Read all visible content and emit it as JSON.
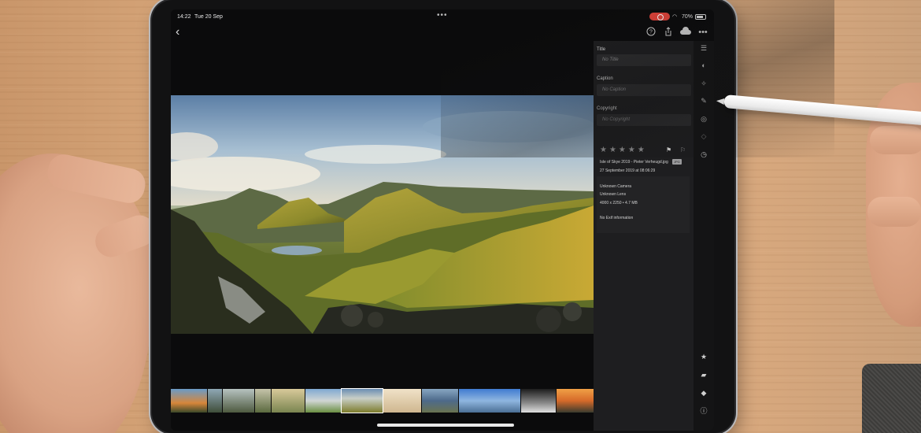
{
  "status_bar": {
    "time": "14:22",
    "date": "Tue 20 Sep",
    "battery": "70%"
  },
  "info_panel": {
    "title_label": "Title",
    "title_placeholder": "No Title",
    "caption_label": "Caption",
    "caption_placeholder": "No Caption",
    "copyright_label": "Copyright",
    "copyright_placeholder": "No Copyright",
    "rating_stars": "★★★★★",
    "file_name": "Isle of Skye 2019 - Pieter Verheugd.jpg",
    "file_type": "JPG",
    "capture_date": "27 September 2019 at 08:06:29",
    "camera": "Unknown Camera",
    "lens": "Unknown Lens",
    "dimensions": "4000 x 2250 • 4.7 MB",
    "exif": "No Exif information"
  },
  "icons": {
    "back": "chevron-left-icon",
    "help": "help-icon",
    "share": "share-icon",
    "cloud": "cloud-icon",
    "more": "more-icon",
    "rail": [
      "sliders-icon",
      "selective-icon",
      "heal-icon",
      "crop-icon",
      "geometry-icon",
      "presets-icon",
      "versions-icon",
      "star-icon",
      "comment-icon",
      "tag-icon",
      "info-icon"
    ]
  },
  "colors": {
    "accent": "#e0433a",
    "panel": "#1e1e20",
    "rail": "#141415"
  }
}
